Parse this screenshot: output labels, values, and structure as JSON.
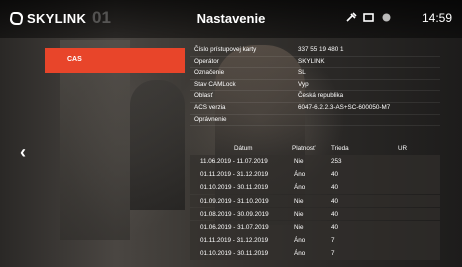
{
  "header": {
    "brand": "SKYLINK",
    "channel_number": "01",
    "title": "Nastavenie",
    "time": "14:59",
    "status_icons": [
      "card-reader-icon",
      "screen-icon",
      "record-dot-icon"
    ]
  },
  "menu": {
    "selected_item": "CAS"
  },
  "info": [
    {
      "key": "Číslo prístupovej karty",
      "value": "337 55 19 480 1"
    },
    {
      "key": "Operátor",
      "value": "SKYLINK"
    },
    {
      "key": "Označenie",
      "value": "SL"
    },
    {
      "key": "Stav CAMLock",
      "value": "Vyp"
    },
    {
      "key": "Oblasť",
      "value": "Česká republika"
    },
    {
      "key": "ACS verzia",
      "value": "6047-6.2.2.3-AS+SC-600050-M7"
    },
    {
      "key": "Oprávnenie",
      "value": ""
    }
  ],
  "table": {
    "headers": {
      "date": "Dátum",
      "valid": "Platnosť",
      "class": "Trieda",
      "ur": "UR"
    },
    "rows": [
      {
        "date": "11.06.2019 - 11.07.2019",
        "valid": "Nie",
        "class": "253"
      },
      {
        "date": "01.11.2019 - 31.12.2019",
        "valid": "Áno",
        "class": "40"
      },
      {
        "date": "01.10.2019 - 30.11.2019",
        "valid": "Áno",
        "class": "40"
      },
      {
        "date": "01.09.2019 - 31.10.2019",
        "valid": "Nie",
        "class": "40"
      },
      {
        "date": "01.08.2019 - 30.09.2019",
        "valid": "Nie",
        "class": "40"
      },
      {
        "date": "01.06.2019 - 31.07.2019",
        "valid": "Nie",
        "class": "40"
      },
      {
        "date": "01.11.2019 - 31.12.2019",
        "valid": "Áno",
        "class": "7"
      },
      {
        "date": "01.10.2019 - 30.11.2019",
        "valid": "Áno",
        "class": "7"
      }
    ]
  },
  "colors": {
    "accent": "#e8452a"
  }
}
